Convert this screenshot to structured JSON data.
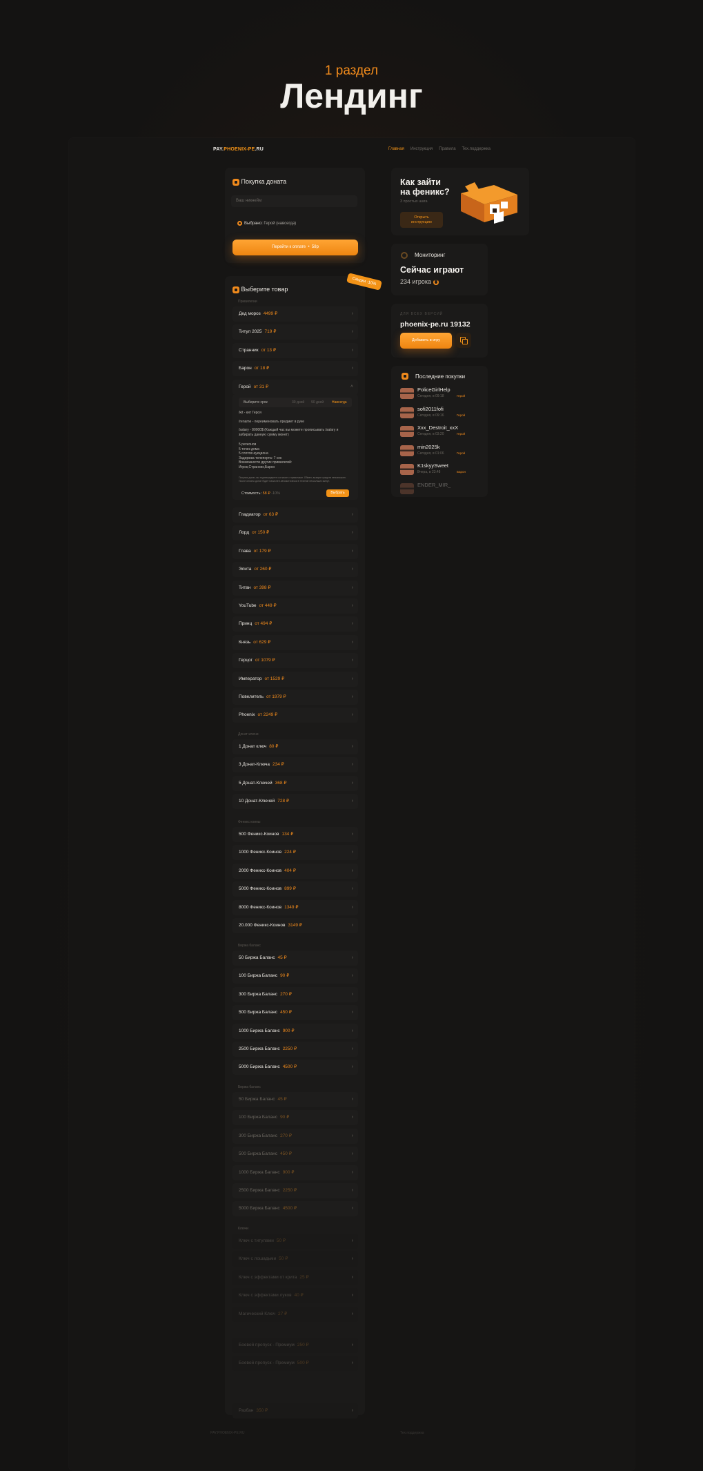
{
  "hero": {
    "subtitle": "1 раздел",
    "title": "Лендинг"
  },
  "header": {
    "logo_a": "PAY.",
    "logo_b": "PHOENIX-PE",
    "logo_c": ".RU",
    "nav": [
      "Главная",
      "Инструкция",
      "Правила",
      "Тех.поддержка"
    ]
  },
  "donate": {
    "title": "Покупка доната",
    "nick_placeholder": "Ваш никнейм",
    "selected_label": "Выбрано:",
    "selected_value": "Герой (навсегда)",
    "pay_label": "Перейти к оплате",
    "pay_price": "58р"
  },
  "catalog": {
    "title": "Выберите товар",
    "discount": "Скидки -10%",
    "groups": [
      {
        "name": "Привилегии",
        "items": [
          {
            "name": "Дед мороз",
            "price": "4499 ₽"
          },
          {
            "name": "Титул 2025",
            "price": "719 ₽"
          },
          {
            "name": "Странник",
            "price": "от 13 ₽"
          },
          {
            "name": "Барон",
            "price": "от 18 ₽"
          },
          {
            "name": "Герой",
            "price": "от 31 ₽",
            "expanded": true
          },
          {
            "name": "Гладиатор",
            "price": "от 63 ₽"
          },
          {
            "name": "Лорд",
            "price": "от 150 ₽"
          },
          {
            "name": "Глава",
            "price": "от 179 ₽"
          },
          {
            "name": "Элита",
            "price": "от 260 ₽"
          },
          {
            "name": "Титан",
            "price": "от 398 ₽"
          },
          {
            "name": "YouTube",
            "price": "от 449 ₽"
          },
          {
            "name": "Принц",
            "price": "от 494 ₽"
          },
          {
            "name": "Князь",
            "price": "от 629 ₽"
          },
          {
            "name": "Герцог",
            "price": "от 1079 ₽"
          },
          {
            "name": "Император",
            "price": "от 1529 ₽"
          },
          {
            "name": "Повелитель",
            "price": "от 1979 ₽"
          },
          {
            "name": "Phoenix",
            "price": "от 2249 ₽"
          }
        ]
      },
      {
        "name": "Донат ключи",
        "items": [
          {
            "name": "1 Донат ключ",
            "price": "80 ₽"
          },
          {
            "name": "3 Донат-Ключа",
            "price": "234 ₽"
          },
          {
            "name": "5 Донат-Ключей",
            "price": "368 ₽"
          },
          {
            "name": "10 Донат-Ключей",
            "price": "728 ₽"
          }
        ]
      },
      {
        "name": "Феникс коины",
        "items": [
          {
            "name": "500 Феникс-Коинов",
            "price": "134 ₽"
          },
          {
            "name": "1000 Феникс-Коинов",
            "price": "224 ₽"
          },
          {
            "name": "2000 Феникс-Коинов",
            "price": "404 ₽"
          },
          {
            "name": "5000 Феникс-Коинов",
            "price": "899 ₽"
          },
          {
            "name": "8000 Феникс-Коинов",
            "price": "1349 ₽"
          },
          {
            "name": "20.000 Феникс-Коинов",
            "price": "3149 ₽"
          }
        ]
      },
      {
        "name": "Биржа баланс",
        "items": [
          {
            "name": "50 Биржа Баланс",
            "price": "45 ₽"
          },
          {
            "name": "100 Биржа Баланс",
            "price": "90 ₽"
          },
          {
            "name": "300 Биржа Баланс",
            "price": "270 ₽"
          },
          {
            "name": "500 Биржа Баланс",
            "price": "450 ₽"
          },
          {
            "name": "1000 Биржа Баланс",
            "price": "900 ₽"
          },
          {
            "name": "2500 Биржа Баланс",
            "price": "2250 ₽"
          },
          {
            "name": "5000 Биржа Баланс",
            "price": "4500 ₽"
          }
        ]
      },
      {
        "name": "Биржа баланс",
        "items": [
          {
            "name": "50 Биржа Баланс",
            "price": "45 ₽"
          },
          {
            "name": "100 Биржа Баланс",
            "price": "90 ₽"
          },
          {
            "name": "300 Биржа Баланс",
            "price": "270 ₽"
          },
          {
            "name": "500 Биржа Баланс",
            "price": "450 ₽"
          },
          {
            "name": "1000 Биржа Баланс",
            "price": "900 ₽"
          },
          {
            "name": "2500 Биржа Баланс",
            "price": "2250 ₽"
          },
          {
            "name": "5000 Биржа Баланс",
            "price": "4500 ₽"
          }
        ]
      },
      {
        "name": "Ключи",
        "items": [
          {
            "name": "Ключ с титулами",
            "price": "50 ₽"
          },
          {
            "name": "Ключ с лошадьми",
            "price": "50 ₽"
          },
          {
            "name": "Ключ с эффектами от крита",
            "price": "25 ₽"
          },
          {
            "name": "Ключ с эффектами луков",
            "price": "40 ₽"
          },
          {
            "name": "Магический Ключ",
            "price": "27 ₽"
          }
        ]
      },
      {
        "name": "",
        "items": [
          {
            "name": "Боевой пропуск - Премиум",
            "price": "250 ₽"
          },
          {
            "name": "Боевой пропуск - Премиум",
            "price": "500 ₽"
          }
        ]
      },
      {
        "name": "",
        "items": [
          {
            "name": "Разбан",
            "price": "350 ₽"
          }
        ]
      }
    ],
    "expanded": {
      "period_label": "Выберите срок",
      "opt1": "30 дней",
      "opt2": "90 дней",
      "opt3": "Навсегда",
      "line1": "/kit - кит Героя",
      "line2": "/rename - переименовать предмет в руке",
      "line3": "/salary - 80000$ (Каждый час вы можете прописывать /salary и\nзабирать данную сумму монет)",
      "line4": "5 регионов\n5 точек дома\n5 слотов аукциона\nЗадержка телепорта: 7 сек\nВозможности других привилегий:\nИгрок,Странник,Барон",
      "note": "Покупая донат, вы подтверждаете согласие с правилами. Обмен, возврат средств невозможен. После оплаты донат будет начислен автоматически в течение нескольких минут.",
      "cost_label": "Стоимость:",
      "cost_price": "58 ₽",
      "cost_discount": "-10%",
      "choose": "Выбрать"
    }
  },
  "howto": {
    "title_1": "Как зайти",
    "title_2": "на феникс?",
    "sub": "3 простых шага",
    "btn_1": "Открыть",
    "btn_2": "инструкцию"
  },
  "monitoring": {
    "title": "Мониторинг",
    "playing": "Сейчас играют",
    "count": "234 игрока"
  },
  "version": {
    "label": "ДЛЯ ВСЕХ ВЕРСИЙ",
    "server": "phoenix-pe.ru 19132",
    "add": "Добавить в игру"
  },
  "last": {
    "title": "Последние покупки",
    "buyers": [
      {
        "name": "PoliceGirlHelp",
        "time": "Сегодня, в 09:18",
        "item": "Герой"
      },
      {
        "name": "sofi2011fofi",
        "time": "Сегодня, в 09:16",
        "item": "Герой"
      },
      {
        "name": "Xxx_Destroit_xxX",
        "time": "Сегодня, в 03:20",
        "item": "Герой"
      },
      {
        "name": "min2025k",
        "time": "Сегодня, в 01:06",
        "item": "Герой"
      },
      {
        "name": "K1skyySweet",
        "time": "Вчера, в 23:48",
        "item": "Барон"
      },
      {
        "name": "ENDER_MIR_",
        "time": "",
        "item": ""
      }
    ]
  },
  "footer": {
    "left": "PAY.PHOENIX-PE.RU",
    "right": "Тех.поддержка"
  },
  "colors": {
    "accent": "#f39317",
    "bg": "#141312",
    "card": "#1b1a19"
  }
}
